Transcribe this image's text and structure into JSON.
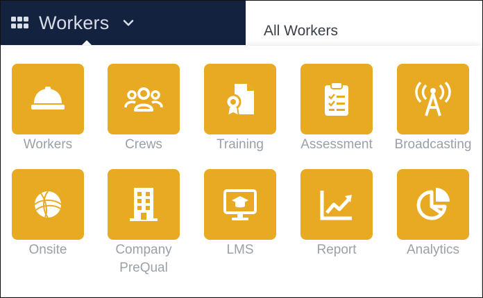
{
  "header": {
    "app_switch_label": "Workers",
    "tab_label": "All Workers"
  },
  "colors": {
    "nav_bg": "#13223f",
    "tile_bg": "#e8aa23",
    "label_text": "#9aa0a7"
  },
  "apps": [
    {
      "label": "Workers",
      "icon": "hard-hat-icon"
    },
    {
      "label": "Crews",
      "icon": "crew-people-icon"
    },
    {
      "label": "Training",
      "icon": "certificate-document-icon"
    },
    {
      "label": "Assessment",
      "icon": "clipboard-checklist-icon"
    },
    {
      "label": "Broadcasting",
      "icon": "antenna-broadcast-icon"
    },
    {
      "label": "Onsite",
      "icon": "onsite-globe-icon"
    },
    {
      "label": "Company\nPreQual",
      "icon": "building-icon"
    },
    {
      "label": "LMS",
      "icon": "monitor-graduation-cap-icon"
    },
    {
      "label": "Report",
      "icon": "line-chart-icon"
    },
    {
      "label": "Analytics",
      "icon": "pie-chart-icon"
    }
  ]
}
